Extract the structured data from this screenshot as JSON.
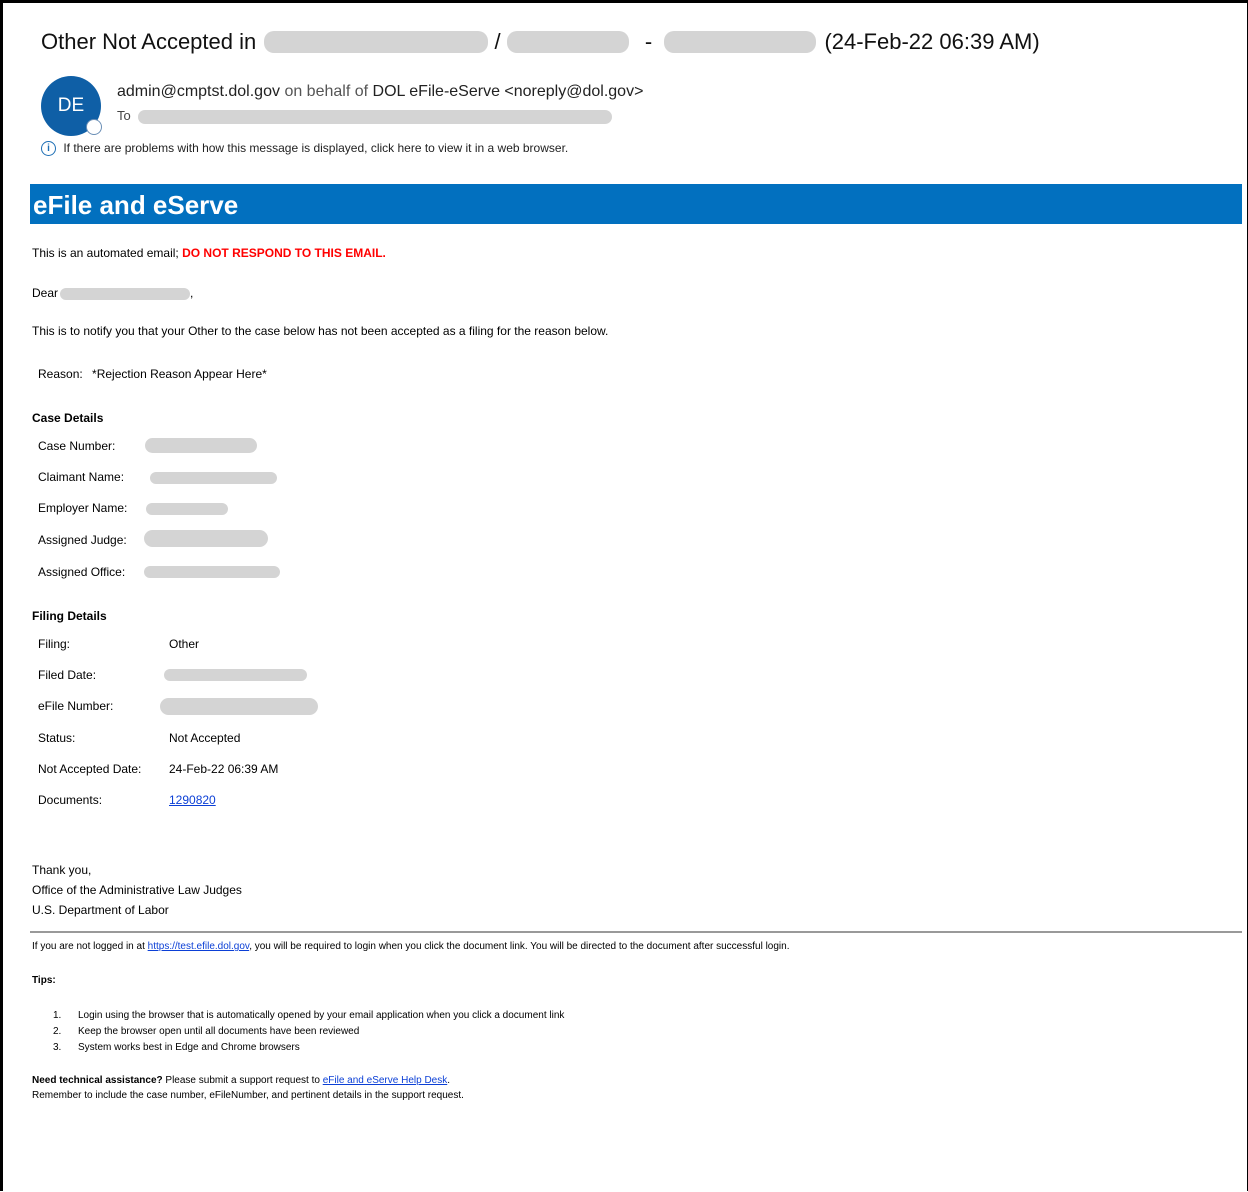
{
  "subject": {
    "prefix": "Other Not Accepted in",
    "sep1": "/",
    "sep2": "-",
    "date": "(24-Feb-22 06:39 AM)"
  },
  "sender": {
    "avatar_initials": "DE",
    "address": "admin@cmptst.dol.gov",
    "behalf": "on behalf of",
    "name": "DOL eFile-eServe <noreply@dol.gov>",
    "to_label": "To"
  },
  "info_bar": {
    "icon": "info-icon",
    "text": "If there are problems with how this message is displayed, click here to view it in a web browser."
  },
  "banner": {
    "title": "eFile and eServe",
    "color": "#0270bf"
  },
  "body": {
    "automated": "This is an automated email;",
    "warning": "DO NOT RESPOND TO THIS EMAIL.",
    "dear": "Dear",
    "dear_comma": ",",
    "notify": "This is to notify you that your Other to the case below has not been accepted as a filing for the reason below.",
    "reason_label": "Reason:",
    "reason_value": "*Rejection Reason Appear Here*"
  },
  "case_details": {
    "heading": "Case Details",
    "case_number": "Case Number:",
    "claimant_name": "Claimant Name:",
    "employer_name": "Employer Name:",
    "assigned_judge": "Assigned Judge:",
    "assigned_office": "Assigned Office:"
  },
  "filing_details": {
    "heading": "Filing Details",
    "filing_label": "Filing:",
    "filing_value": "Other",
    "filed_date_label": "Filed Date:",
    "efile_number_label": "eFile Number:",
    "status_label": "Status:",
    "status_value": "Not Accepted",
    "not_accepted_date_label": "Not Accepted Date:",
    "not_accepted_date_value": "24-Feb-22 06:39 AM",
    "documents_label": "Documents:",
    "documents_link": "1290820"
  },
  "signature": {
    "line1": "Thank you,",
    "line2": "Office of the Administrative Law Judges",
    "line3": "U.S. Department of Labor"
  },
  "footer": {
    "login_pre": "If you are not logged in at",
    "login_link": "https://test.efile.dol.gov",
    "login_post": ", you will be required to login when you click the document link. You will be directed to the document after successful login.",
    "tips_heading": "Tips:",
    "tips": [
      "Login using the browser that is automatically opened by your email application when you click a document link",
      "Keep the browser open until all documents have been reviewed",
      "System works best in Edge and Chrome browsers"
    ],
    "assist_bold": "Need technical assistance?",
    "assist_text": "Please submit a support request to",
    "assist_link": "eFile and eServe Help Desk",
    "assist_end": ".",
    "remember": "Remember to include the case number, eFileNumber, and pertinent details in the support request."
  }
}
